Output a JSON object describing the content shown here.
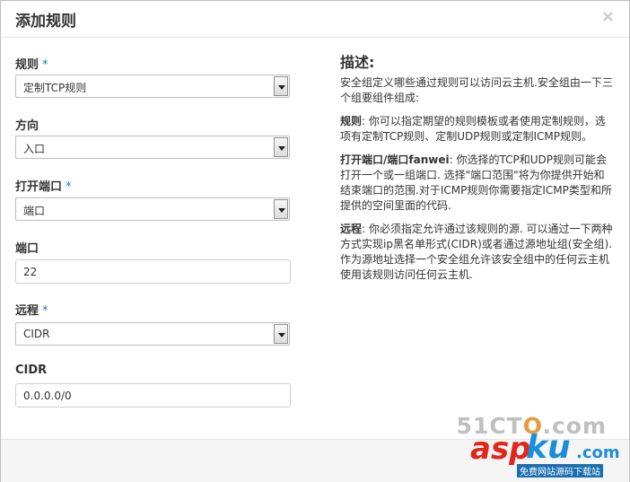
{
  "dialog": {
    "title": "添加规则",
    "close_label": "×"
  },
  "form": {
    "rule": {
      "label": "规则",
      "required_mark": "*",
      "value": "定制TCP规则"
    },
    "direction": {
      "label": "方向",
      "value": "入口"
    },
    "open_port": {
      "label": "打开端口",
      "required_mark": "*",
      "value": "端口"
    },
    "port": {
      "label": "端口",
      "value": "22"
    },
    "remote": {
      "label": "远程",
      "required_mark": "*",
      "value": "CIDR"
    },
    "cidr": {
      "label": "CIDR",
      "value": "0.0.0.0/0"
    }
  },
  "description": {
    "title": "描述:",
    "intro": "安全组定义哪些通过规则可以访问云主机.安全组由一下三个组要组件组成:",
    "rule_term": "规则",
    "rule_text": ": 你可以指定期望的规则模板或者使用定制规则，选项有定制TCP规则、定制UDP规则或定制ICMP规则。",
    "port_term": "打开端口/端口fanwei",
    "port_text": ": 你选择的TCP和UDP规则可能会打开一个或一组端口. 选择\"端口范围\"将为你提供开始和结束端口的范围.对于ICMP规则你需要指定ICMP类型和所提供的空间里面的代码.",
    "remote_term": "远程",
    "remote_text": ": 你必须指定允许通过该规则的源. 可以通过一下两种方式实现ip黑名单形式(CIDR)或者通过源地址组(安全组). 作为源地址选择一个安全组允许该安全组中的任何云主机使用该规则访问任何云主机."
  },
  "watermark": {
    "site_prefix": "51CT",
    "site_o": "O",
    "site_suffix": ".com",
    "brand_a": "asp",
    "brand_b": "ku",
    "brand_c": ".com",
    "tagline": "免费网站源码下载站"
  }
}
